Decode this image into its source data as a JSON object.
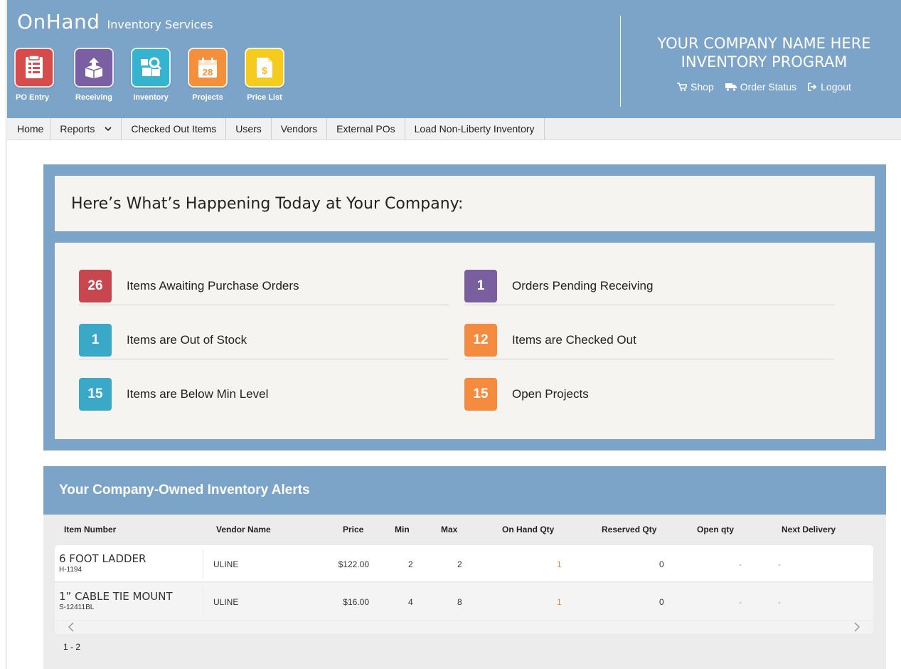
{
  "brand": {
    "name": "OnHand",
    "subtitle": "Inventory Services"
  },
  "apps": [
    {
      "label": "PO Entry",
      "icon": "document-list-icon",
      "color": "#d64b4b"
    },
    {
      "label": "Receiving",
      "icon": "box-receive-icon",
      "color": "#7b5fa3"
    },
    {
      "label": "Inventory",
      "icon": "box-search-icon",
      "color": "#35b3cf"
    },
    {
      "label": "Projects",
      "icon": "calendar-icon",
      "color": "#f48f3b",
      "day": "28"
    },
    {
      "label": "Price List",
      "icon": "price-document-icon",
      "color": "#f5cc1e"
    }
  ],
  "company": {
    "line1": "YOUR COMPANY NAME HERE",
    "line2": "INVENTORY PROGRAM"
  },
  "header_links": [
    {
      "label": "Shop",
      "icon": "cart-icon"
    },
    {
      "label": "Order Status",
      "icon": "truck-icon"
    },
    {
      "label": "Logout",
      "icon": "logout-icon"
    }
  ],
  "nav": [
    {
      "label": "Home"
    },
    {
      "label": "Reports"
    },
    {
      "label": "Checked Out Items"
    },
    {
      "label": "Users"
    },
    {
      "label": "Vendors"
    },
    {
      "label": "External POs"
    },
    {
      "label": "Load Non-Liberty Inventory"
    }
  ],
  "summary": {
    "title": "Here’s What’s Happening Today at Your Company:",
    "stats": [
      {
        "count": "26",
        "label": "Items Awaiting Purchase Orders",
        "color": "#c8474f"
      },
      {
        "count": "1",
        "label": "Orders Pending Receiving",
        "color": "#7a5fa0"
      },
      {
        "count": "1",
        "label": "Items are Out of Stock",
        "color": "#3aa9c8"
      },
      {
        "count": "12",
        "label": "Items are Checked Out",
        "color": "#f48b3f"
      },
      {
        "count": "15",
        "label": "Items are Below Min Level",
        "color": "#3aa9c8"
      },
      {
        "count": "15",
        "label": "Open Projects",
        "color": "#f48b3f"
      }
    ]
  },
  "alerts": {
    "title": "Your Company-Owned Inventory Alerts",
    "columns": [
      "Item Number",
      "Vendor Name",
      "Price",
      "Min",
      "Max",
      "On Hand Qty",
      "Reserved Qty",
      "Open qty",
      "Next Delivery"
    ],
    "rows": [
      {
        "name": "6 FOOT LADDER",
        "code": "H-1194",
        "vendor": "ULINE",
        "price": "$122.00",
        "min": "2",
        "max": "2",
        "on_hand": "1",
        "reserved": "0",
        "open": "-",
        "next": "-"
      },
      {
        "name": "1” CABLE TIE MOUNT",
        "code": "S-12411BL",
        "vendor": "ULINE",
        "price": "$16.00",
        "min": "4",
        "max": "8",
        "on_hand": "1",
        "reserved": "0",
        "open": "-",
        "next": "-"
      }
    ],
    "pager": "1 - 2"
  }
}
